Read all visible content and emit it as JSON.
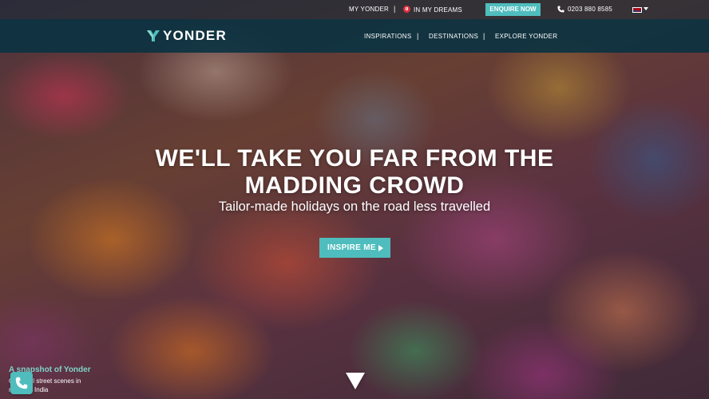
{
  "topbar": {
    "my_yonder": "MY YONDER",
    "separator": "|",
    "in_my_dreams": "IN MY DREAMS",
    "enquire": "ENQUIRE NOW",
    "phone": "0203 880 8585",
    "language_icon": "uk-flag-icon"
  },
  "navbar": {
    "logo_text": "YONDER",
    "items": [
      {
        "label": "INSPIRATIONS"
      },
      {
        "label": "DESTINATIONS"
      },
      {
        "label": "EXPLORE YONDER"
      }
    ],
    "separator": "|"
  },
  "hero": {
    "headline_line1": "WE'LL TAKE YOU FAR FROM THE",
    "headline_line2": "MADDING CROWD",
    "subheadline": "Tailor-made holidays on the road less travelled",
    "cta_label": "INSPIRE ME"
  },
  "snapshot": {
    "title": "A snapshot of Yonder",
    "description": "Colourful street scenes in northern India"
  },
  "colors": {
    "accent": "#4fbdbd",
    "navbar": "#0a3241",
    "heart": "#e0303f"
  }
}
